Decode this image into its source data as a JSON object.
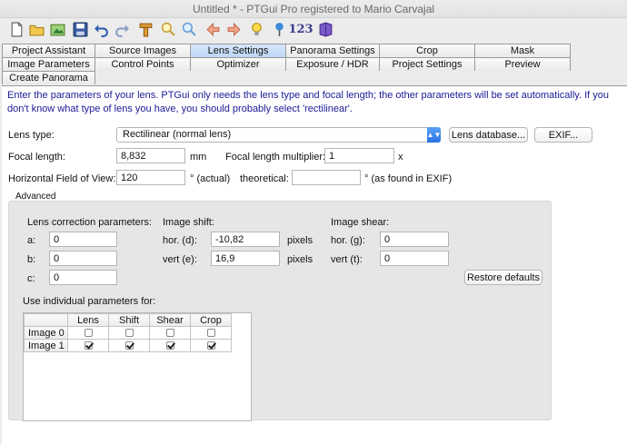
{
  "window": {
    "title": "Untitled * - PTGui Pro registered to Mario Carvajal"
  },
  "toolbar": {
    "icons": [
      "new-document-icon",
      "open-folder-icon",
      "load-images-icon",
      "save-icon",
      "undo-icon",
      "redo-icon",
      "crop-icon",
      "zoom-in-icon",
      "zoom-out-icon",
      "back-arrow-icon",
      "forward-arrow-icon",
      "light-bulb-icon",
      "pin-icon",
      "numbers-icon",
      "help-book-icon"
    ],
    "numbers_label": "123"
  },
  "tabs_row1": [
    "Project Assistant",
    "Source Images",
    "Lens Settings",
    "Panorama Settings",
    "Crop",
    "Mask"
  ],
  "tabs_row2": [
    "Image Parameters",
    "Control Points",
    "Optimizer",
    "Exposure / HDR",
    "Project Settings",
    "Preview"
  ],
  "tabs_row3": [
    "Create Panorama"
  ],
  "active_tab": "Lens Settings",
  "intro_text": "Enter the parameters of your lens. PTGui only needs the lens type and focal length; the other parameters will be set automatically. If you don't know what type of lens you have, you should probably select 'rectilinear'.",
  "lens": {
    "type_label": "Lens type:",
    "type_value": "Rectilinear (normal lens)",
    "database_button": "Lens database...",
    "exif_button": "EXIF...",
    "focal_label": "Focal length:",
    "focal_value": "8,832",
    "focal_unit": "mm",
    "multiplier_label": "Focal length multiplier:",
    "multiplier_value": "1",
    "multiplier_unit": "x",
    "hfov_label": "Horizontal Field of View:",
    "hfov_value": "120",
    "hfov_actual": "° (actual)",
    "theoretical_label": "theoretical:",
    "theoretical_value": "",
    "theoretical_note": "° (as found in EXIF)"
  },
  "advanced": {
    "title": "Advanced",
    "correction_title": "Lens correction parameters:",
    "a_label": "a:",
    "a_value": "0",
    "b_label": "b:",
    "b_value": "0",
    "c_label": "c:",
    "c_value": "0",
    "shift_title": "Image shift:",
    "hor_d_label": "hor. (d):",
    "hor_d_value": "-10,82",
    "vert_e_label": "vert (e):",
    "vert_e_value": "16,9",
    "pixels_label": "pixels",
    "shear_title": "Image shear:",
    "hor_g_label": "hor. (g):",
    "hor_g_value": "0",
    "vert_t_label": "vert (t):",
    "vert_t_value": "0",
    "restore_button": "Restore defaults",
    "individual_title": "Use individual parameters for:",
    "grid_headers": [
      "Lens",
      "Shift",
      "Shear",
      "Crop"
    ],
    "grid_rows": [
      {
        "name": "Image 0",
        "checks": [
          false,
          false,
          false,
          false
        ]
      },
      {
        "name": "Image 1",
        "checks": [
          true,
          true,
          true,
          true
        ]
      }
    ]
  }
}
